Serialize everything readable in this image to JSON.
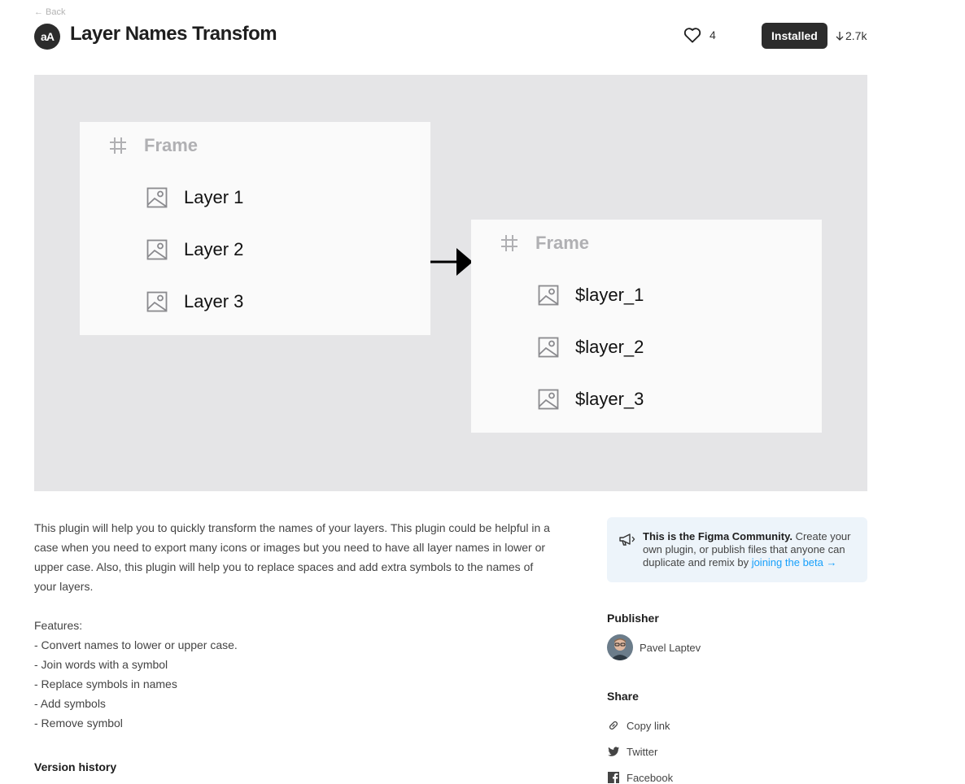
{
  "header": {
    "back_label": "← Back",
    "logo_text": "aA",
    "title": "Layer Names Transfom",
    "like_count": "4",
    "installed_label": "Installed",
    "downloads": "2.7k"
  },
  "preview": {
    "left_panel": {
      "frame_label": "Frame",
      "layers": [
        "Layer 1",
        "Layer 2",
        "Layer 3"
      ]
    },
    "right_panel": {
      "frame_label": "Frame",
      "layers": [
        "$layer_1",
        "$layer_2",
        "$layer_3"
      ]
    }
  },
  "description": {
    "paragraph": "This plugin will help you to quickly transform the names of your layers. This plugin could be helpful in a case when you need to export many icons or images but you need to have all layer names in lower or upper case. Also, this plugin will help you to replace spaces and add extra symbols to the names of your layers.",
    "features_heading": "Features:",
    "features": [
      "- Convert names to lower or upper case.",
      "- Join words with a symbol",
      "- Replace symbols in names",
      "- Add symbols",
      "- Remove symbol"
    ],
    "version_history_label": "Version history"
  },
  "sidebar": {
    "community": {
      "bold_text": "This is the Figma Community.",
      "text": " Create your own plugin, or publish files that anyone can duplicate and remix by ",
      "link_text": "joining the beta →"
    },
    "publisher_title": "Publisher",
    "publisher_name": "Pavel Laptev",
    "share_title": "Share",
    "share_items": [
      "Copy link",
      "Twitter",
      "Facebook"
    ]
  },
  "colors": {
    "preview_bg": "#e5e5e7",
    "panel_bg": "#fafafa",
    "button_dark": "#2c2c2c",
    "link_blue": "#18a0fb",
    "community_bg": "#edf4fa"
  }
}
